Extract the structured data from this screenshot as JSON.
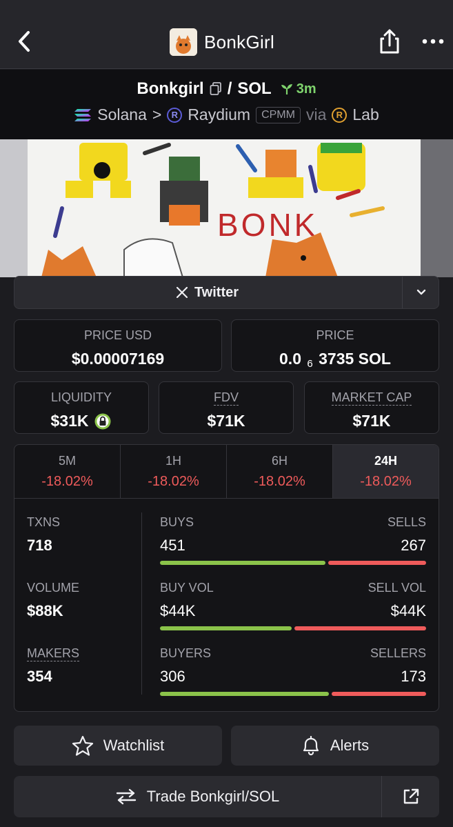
{
  "header": {
    "title": "BonkGirl",
    "logo_text": "BONK"
  },
  "pair": {
    "token": "Bonkgirl",
    "separator": "/",
    "quote": "SOL",
    "age": "3m",
    "chain": "Solana",
    "breadcrumb_sep": ">",
    "dex": "Raydium",
    "pool_type": "CPMM",
    "via": "via",
    "launchpad": "Lab"
  },
  "banner": {
    "drawing_text": "BONK"
  },
  "socials": {
    "twitter_label": "Twitter"
  },
  "prices": {
    "price_usd_label": "PRICE USD",
    "price_usd_value": "$0.00007169",
    "price_label": "PRICE",
    "price_sol_prefix": "0.0",
    "price_sol_subscript": "6",
    "price_sol_digits": "3735 SOL"
  },
  "metrics": {
    "liquidity_label": "LIQUIDITY",
    "liquidity_value": "$31K",
    "fdv_label": "FDV",
    "fdv_value": "$71K",
    "mcap_label": "MARKET CAP",
    "mcap_value": "$71K"
  },
  "timeframes": [
    {
      "label": "5M",
      "change": "-18.02%"
    },
    {
      "label": "1H",
      "change": "-18.02%"
    },
    {
      "label": "6H",
      "change": "-18.02%"
    },
    {
      "label": "24H",
      "change": "-18.02%"
    }
  ],
  "activity": {
    "txns_label": "TXNS",
    "txns_value": "718",
    "volume_label": "VOLUME",
    "volume_value": "$88K",
    "makers_label": "MAKERS",
    "makers_value": "354",
    "buys_label": "BUYS",
    "buys_value": "451",
    "sells_label": "SELLS",
    "sells_value": "267",
    "buys_share": 0.628,
    "buyvol_label": "BUY VOL",
    "buyvol_value": "$44K",
    "sellvol_label": "SELL VOL",
    "sellvol_value": "$44K",
    "buyvol_share": 0.5,
    "buyers_label": "BUYERS",
    "buyers_value": "306",
    "sellers_label": "SELLERS",
    "sellers_value": "173",
    "buyers_share": 0.639
  },
  "actions": {
    "watchlist_label": "Watchlist",
    "alerts_label": "Alerts",
    "trade_label": "Trade Bonkgirl/SOL"
  },
  "colors": {
    "green": "#8bc34a",
    "red": "#ef5b5b",
    "age_green": "#7fd36d"
  }
}
